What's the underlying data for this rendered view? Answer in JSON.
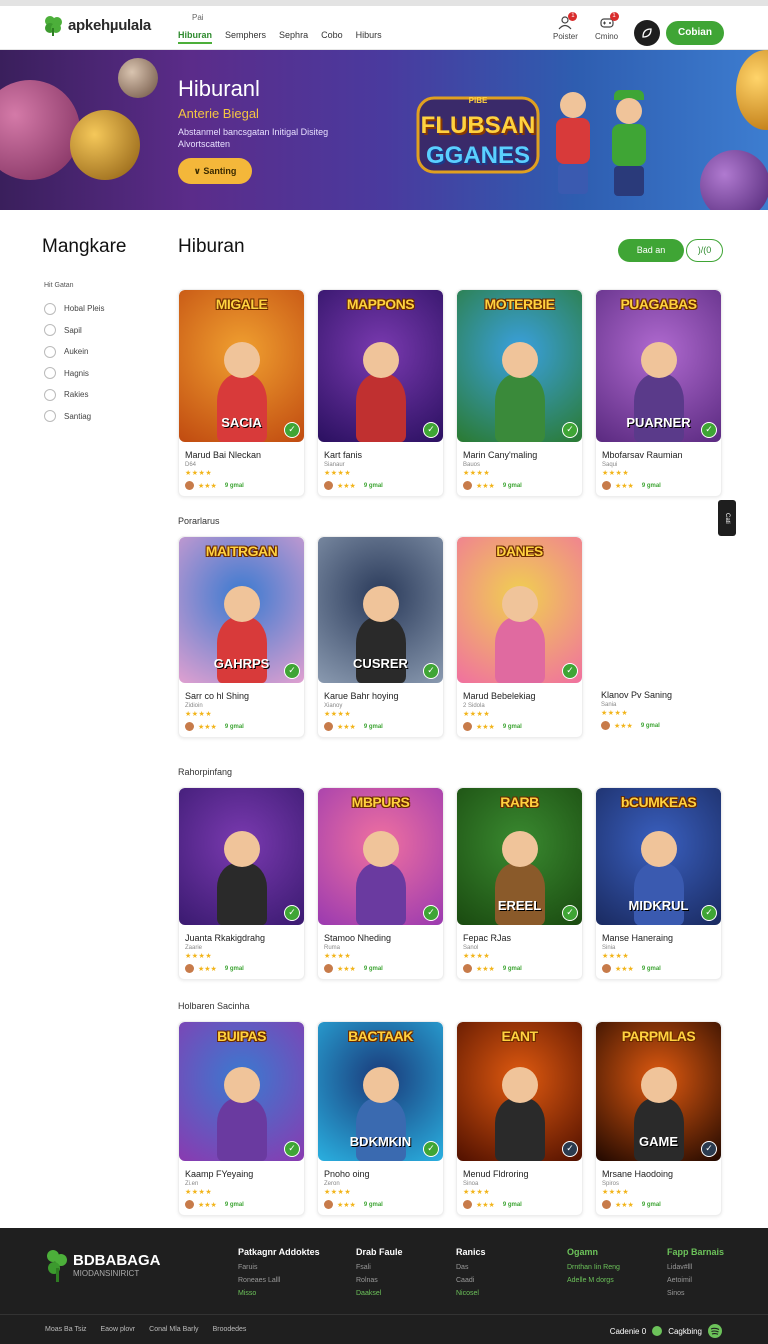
{
  "header": {
    "brand": "apkehµulala",
    "nav_top": "Pai",
    "nav": [
      "Hiburan",
      "Semphers",
      "Sephra",
      "Cobo",
      "Hiburs"
    ],
    "icons": [
      {
        "label": "Poister",
        "badge": "1"
      },
      {
        "label": "Cmino",
        "badge": "1"
      }
    ],
    "cta": "Cobian"
  },
  "hero": {
    "title": "Hiburanl",
    "subtitle": "Anterie Biegal",
    "description": "Abstanmel bancsgatan Initigal Disiteg Alvortscatten",
    "button": "Santing",
    "logo_line1": "PIBE",
    "logo_line2": "FLUBSAN",
    "logo_line3": "GGANES"
  },
  "sidebar": {
    "title": "Mangkare",
    "filter_title": "Hit Gatan",
    "options": [
      "Hobal Pleis",
      "Sapil",
      "Aukein",
      "Hagnis",
      "Rakies",
      "Santiag"
    ]
  },
  "main": {
    "title": "Hiburan",
    "button_primary": "Bad an",
    "button_secondary": ")/(0",
    "side_tab": "Cati",
    "sections": [
      {
        "label": "",
        "cards": [
          {
            "title": "Marud Bai Nleckan",
            "category": "D64",
            "image_text": "MIGALE",
            "image_sub": "SACIA",
            "stars": "★★★★",
            "price": "9 gmal"
          },
          {
            "title": "Kart fanis",
            "category": "Sianaur",
            "image_text": "MAPPONS",
            "image_sub": "",
            "stars": "★★★★",
            "price": "9 gmal"
          },
          {
            "title": "Marin Cany'maling",
            "category": "Bauos",
            "image_text": "MOTERBIE",
            "image_sub": "",
            "stars": "★★★★",
            "price": "9 gmal"
          },
          {
            "title": "Mbofarsav Raumian",
            "category": "Saqui",
            "image_text": "PUAGABAS",
            "image_sub": "PUARNER",
            "stars": "★★★★",
            "price": "9 gmal"
          }
        ]
      },
      {
        "label": "Porarlarus",
        "cards": [
          {
            "title": "Sarr co hl Shing",
            "category": "Zidioin",
            "image_text": "MAITRGAN",
            "image_sub": "GAHRPS",
            "stars": "★★★★",
            "price": "9 gmal"
          },
          {
            "title": "Karue Bahr hoying",
            "category": "Xianoy",
            "image_text": "",
            "image_sub": "CUSRER",
            "stars": "★★★★",
            "price": "9 gmal"
          },
          {
            "title": "Marud Bebelekiag",
            "category": "2 Sidola",
            "image_text": "DANES",
            "image_sub": "",
            "stars": "★★★★",
            "price": "9 gmal"
          },
          {
            "title": "Klanov Pv Saning",
            "category": "Sania",
            "image_text": "",
            "image_sub": "",
            "stars": "★★★★",
            "price": "9 gmal"
          }
        ]
      },
      {
        "label": "Rahorpinfang",
        "cards": [
          {
            "title": "Juanta Rkakigdrahg",
            "category": "Zaarie",
            "image_text": "",
            "image_sub": "",
            "stars": "★★★★",
            "price": "9 gmal"
          },
          {
            "title": "Stamoo Nheding",
            "category": "Ruma",
            "image_text": "MBPURS",
            "image_sub": "",
            "stars": "★★★★",
            "price": "9 gmal"
          },
          {
            "title": "Fepac RJas",
            "category": "Sanol",
            "image_text": "RARB",
            "image_sub": "EREEL",
            "stars": "★★★★",
            "price": "9 gmal"
          },
          {
            "title": "Manse Haneraing",
            "category": "Sinia",
            "image_text": "bCUMKEAS",
            "image_sub": "MIDKRUL",
            "stars": "★★★★",
            "price": "9 gmal"
          }
        ]
      },
      {
        "label": "Holbaren Sacinha",
        "cards": [
          {
            "title": "Kaamp FYeyaing",
            "category": "Zi.en",
            "image_text": "BUIPAS",
            "image_sub": "",
            "stars": "★★★★",
            "price": "9 gmal"
          },
          {
            "title": "Pnoho oing",
            "category": "Zeron",
            "image_text": "BACTAAK",
            "image_sub": "BDKMKIN",
            "stars": "★★★★",
            "price": "9 gmal"
          },
          {
            "title": "Menud Fldroring",
            "category": "Sinoa",
            "image_text": "EANT",
            "image_sub": "",
            "stars": "★★★★",
            "price": "9 gmal"
          },
          {
            "title": "Mrsane Haodoing",
            "category": "Spiros",
            "image_text": "PARPMLAS",
            "image_sub": "GAME",
            "stars": "★★★★",
            "price": "9 gmal"
          }
        ]
      }
    ]
  },
  "footer": {
    "brand": "BDBABAGA",
    "tagline": "MIODANSINIRICT",
    "cols": [
      {
        "title": "Patkagnr Addoktes",
        "items": [
          "Faruis",
          "Roneaes Lalll",
          "Misso"
        ]
      },
      {
        "title": "Drab Faule",
        "items": [
          "Fsali",
          "Rolnas",
          "Daaksel"
        ]
      },
      {
        "title": "Ranics",
        "items": [
          "Das",
          "Caadi",
          "Nicosel"
        ]
      },
      {
        "title": "Ogamn",
        "items": [
          "Drnthan Iin Reng",
          "Adelle M dorgs"
        ]
      },
      {
        "title": "Fapp Barnais",
        "items": [
          "Lidav#lll",
          "Aetoimil",
          "Sinos"
        ]
      }
    ],
    "bottom_links": [
      "Moas Ba Tsiz",
      "Eaow plovr",
      "Conal Mla Barly",
      "Broodedes"
    ],
    "right_text": "Cadenie 0",
    "right_text2": "Cagkbing"
  },
  "colors": {
    "accent": "#3fa535",
    "footer_bg": "#1f1f1f",
    "hero_start": "#3a1f5c",
    "hero_end": "#3d7dd0"
  }
}
